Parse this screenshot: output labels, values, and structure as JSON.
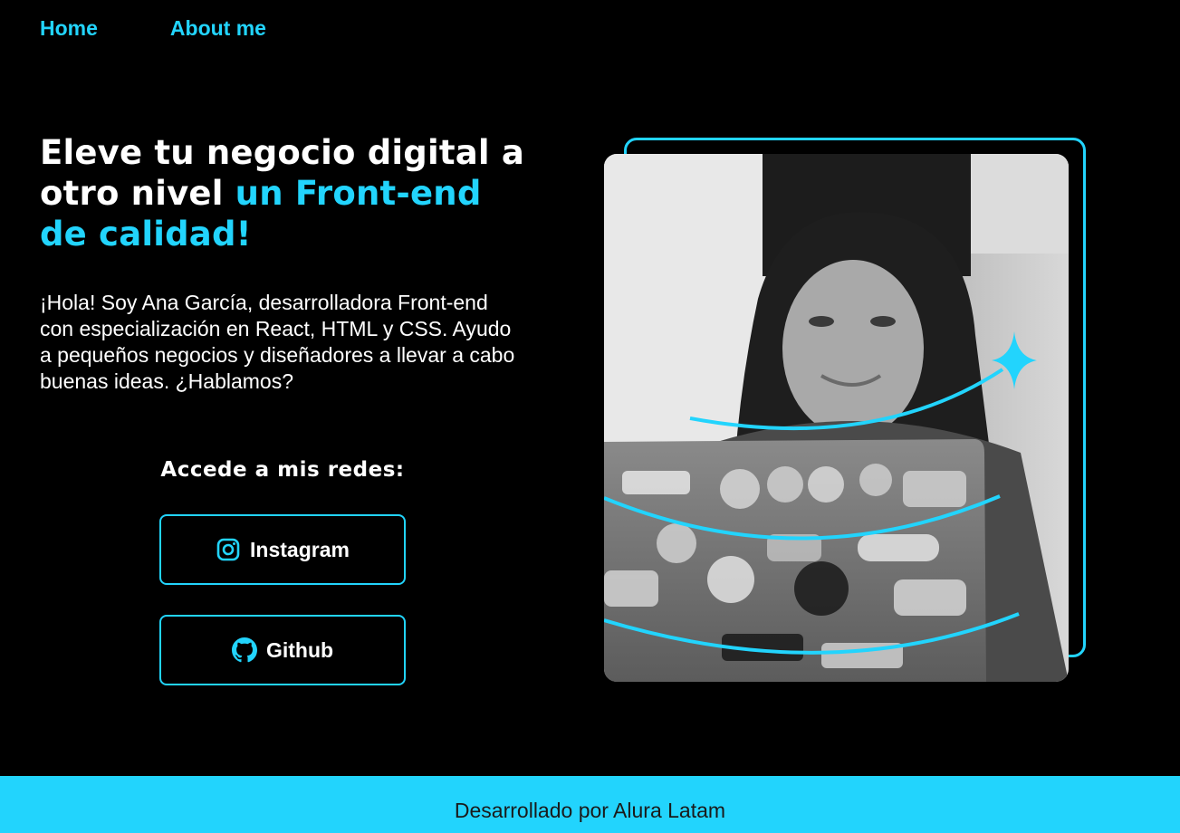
{
  "nav": {
    "home": "Home",
    "about": "About me"
  },
  "hero": {
    "title_part1": "Eleve tu negocio digital a otro nivel ",
    "title_accent": "un Front-end de calidad!",
    "intro": "¡Hola! Soy Ana García, desarrolladora Front-end con especialización en React, HTML y CSS. Ayudo a pequeños negocios y diseñadores a llevar a cabo buenas ideas. ¿Hablamos?"
  },
  "social": {
    "title": "Accede a mis redes:",
    "instagram": "Instagram",
    "github": "Github"
  },
  "footer": {
    "text": "Desarrollado por Alura Latam"
  },
  "colors": {
    "accent": "#22d4fd",
    "background": "#000000",
    "footer_text": "#1a1a1a"
  },
  "icons": {
    "instagram": "instagram-icon",
    "github": "github-icon"
  }
}
